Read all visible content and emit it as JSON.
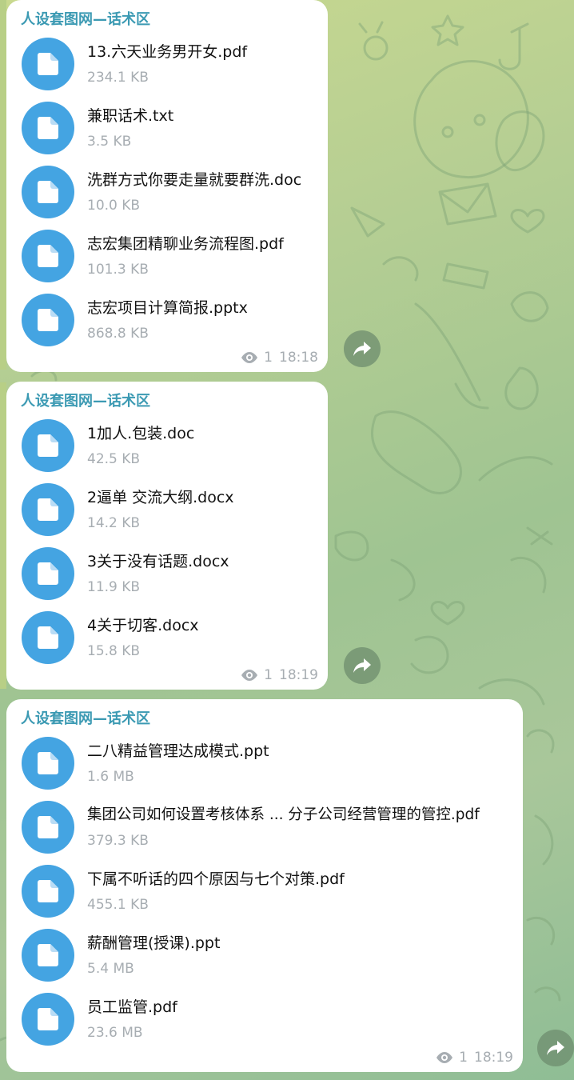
{
  "colors": {
    "sender": "#3c9ab3",
    "file_icon_bg": "#44a4e2",
    "meta_text": "#a7adb2",
    "bubble_bg": "#ffffff"
  },
  "messages": [
    {
      "sender": "人设套图网—话术区",
      "files": [
        {
          "name": "13.六天业务男开女.pdf",
          "size": "234.1 KB",
          "icon": "file-icon"
        },
        {
          "name": "兼职话术.txt",
          "size": "3.5 KB",
          "icon": "file-icon"
        },
        {
          "name": "洗群方式你要走量就要群洗.doc",
          "size": "10.0 KB",
          "icon": "file-icon"
        },
        {
          "name": "志宏集团精聊业务流程图.pdf",
          "size": "101.3 KB",
          "icon": "file-icon"
        },
        {
          "name": "志宏项目计算简报.pptx",
          "size": "868.8 KB",
          "icon": "file-icon"
        }
      ],
      "views": "1",
      "time": "18:18"
    },
    {
      "sender": "人设套图网—话术区",
      "files": [
        {
          "name": "1加人.包装.doc",
          "size": "42.5 KB",
          "icon": "file-icon"
        },
        {
          "name": "2逼单 交流大纲.docx",
          "size": "14.2 KB",
          "icon": "file-icon"
        },
        {
          "name": "3关于没有话题.docx",
          "size": "11.9 KB",
          "icon": "file-icon"
        },
        {
          "name": "4关于切客.docx",
          "size": "15.8 KB",
          "icon": "file-icon"
        }
      ],
      "views": "1",
      "time": "18:19"
    },
    {
      "sender": "人设套图网—话术区",
      "files": [
        {
          "name": "二八精益管理达成模式.ppt",
          "size": "1.6 MB",
          "icon": "file-icon"
        },
        {
          "name": "集团公司如何设置考核体系 ... 分子公司经营管理的管控.pdf",
          "size": "379.3 KB",
          "icon": "file-icon"
        },
        {
          "name": "下属不听话的四个原因与七个对策.pdf",
          "size": "455.1 KB",
          "icon": "file-icon"
        },
        {
          "name": "薪酬管理(授课).ppt",
          "size": "5.4 MB",
          "icon": "file-icon"
        },
        {
          "name": "员工监管.pdf",
          "size": "23.6 MB",
          "icon": "file-icon"
        }
      ],
      "views": "1",
      "time": "18:19"
    }
  ]
}
